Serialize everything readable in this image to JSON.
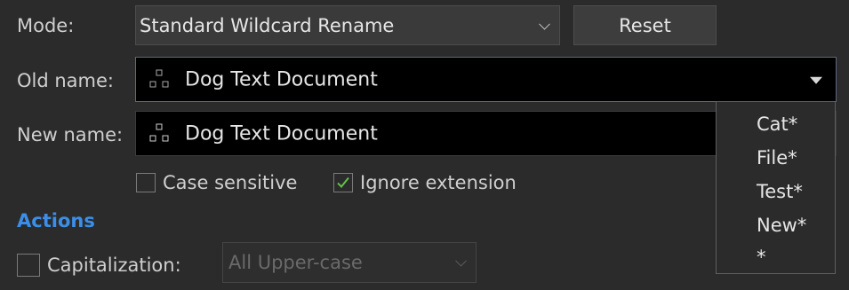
{
  "mode": {
    "label": "Mode:",
    "value": "Standard Wildcard Rename",
    "reset_label": "Reset"
  },
  "old_name": {
    "label": "Old name:",
    "value": "Dog Text Document",
    "icon": "tree-structure-icon"
  },
  "new_name": {
    "label": "New name:",
    "value": "Dog Text Document",
    "icon": "tree-structure-icon"
  },
  "options": {
    "case_sensitive": {
      "label": "Case sensitive",
      "checked": false
    },
    "ignore_extension": {
      "label": "Ignore extension",
      "checked": true
    }
  },
  "actions": {
    "heading": "Actions",
    "capitalization": {
      "label": "Capitalization:",
      "checked": false,
      "value": "All Upper-case"
    }
  },
  "dropdown": {
    "items": [
      "Cat*",
      "File*",
      "Test*",
      "New*",
      "*"
    ]
  },
  "colors": {
    "background": "#2b2b2b",
    "accent": "#3b8fe8",
    "checkmark": "#5fc24a"
  }
}
